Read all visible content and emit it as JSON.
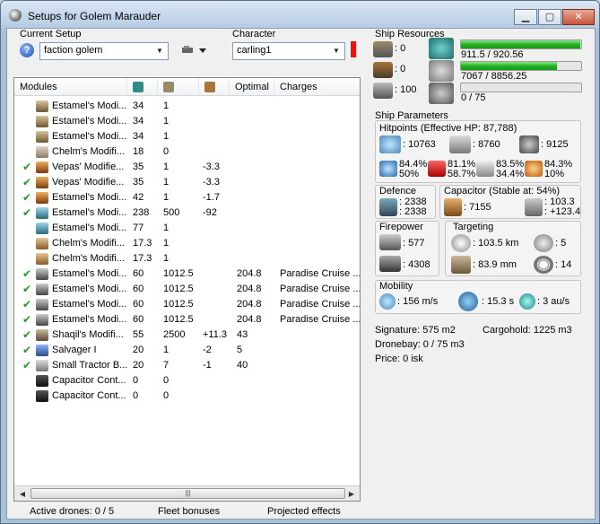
{
  "window": {
    "title": "Setups for Golem Marauder",
    "minimize_glyph": "▁",
    "maximize_glyph": "▢",
    "close_glyph": "✕"
  },
  "current_setup": {
    "label": "Current Setup",
    "value": "faction golem",
    "help_glyph": "?"
  },
  "character": {
    "label": "Character",
    "value": "carling1"
  },
  "modules": {
    "columns": {
      "name": "Modules",
      "optimal": "Optimal",
      "charges": "Charges"
    },
    "header_icons": [
      "cpu-icon",
      "powergrid-icon",
      "capacitor-icon"
    ],
    "rows": [
      {
        "checked": false,
        "icon": "rig-icon",
        "name": "Estamel's Modi...",
        "cpu": "34",
        "pg": "1",
        "cap": "",
        "optimal": "",
        "charges": ""
      },
      {
        "checked": false,
        "icon": "rig-icon",
        "name": "Estamel's Modi...",
        "cpu": "34",
        "pg": "1",
        "cap": "",
        "optimal": "",
        "charges": ""
      },
      {
        "checked": false,
        "icon": "rig-icon",
        "name": "Estamel's Modi...",
        "cpu": "34",
        "pg": "1",
        "cap": "",
        "optimal": "",
        "charges": ""
      },
      {
        "checked": false,
        "icon": "sensor-icon",
        "name": "Chelm's Modifi...",
        "cpu": "18",
        "pg": "0",
        "cap": "",
        "optimal": "",
        "charges": ""
      },
      {
        "checked": true,
        "icon": "hardener-icon",
        "name": "Vepas' Modifie...",
        "cpu": "35",
        "pg": "1",
        "cap": "-3.3",
        "optimal": "",
        "charges": ""
      },
      {
        "checked": true,
        "icon": "hardener-icon",
        "name": "Vepas' Modifie...",
        "cpu": "35",
        "pg": "1",
        "cap": "-3.3",
        "optimal": "",
        "charges": ""
      },
      {
        "checked": true,
        "icon": "hardener-icon",
        "name": "Estamel's Modi...",
        "cpu": "42",
        "pg": "1",
        "cap": "-1.7",
        "optimal": "",
        "charges": ""
      },
      {
        "checked": true,
        "icon": "booster-icon",
        "name": "Estamel's Modi...",
        "cpu": "238",
        "pg": "500",
        "cap": "-92",
        "optimal": "",
        "charges": ""
      },
      {
        "checked": false,
        "icon": "booster-icon",
        "name": "Estamel's Modi...",
        "cpu": "77",
        "pg": "1",
        "cap": "",
        "optimal": "",
        "charges": ""
      },
      {
        "checked": false,
        "icon": "power-icon",
        "name": "Chelm's Modifi...",
        "cpu": "17.3",
        "pg": "1",
        "cap": "",
        "optimal": "",
        "charges": ""
      },
      {
        "checked": false,
        "icon": "power-icon",
        "name": "Chelm's Modifi...",
        "cpu": "17.3",
        "pg": "1",
        "cap": "",
        "optimal": "",
        "charges": ""
      },
      {
        "checked": true,
        "icon": "launcher-icon",
        "name": "Estamel's Modi...",
        "cpu": "60",
        "pg": "1012.5",
        "cap": "",
        "optimal": "204.8",
        "charges": "Paradise Cruise ..."
      },
      {
        "checked": true,
        "icon": "launcher-icon",
        "name": "Estamel's Modi...",
        "cpu": "60",
        "pg": "1012.5",
        "cap": "",
        "optimal": "204.8",
        "charges": "Paradise Cruise ..."
      },
      {
        "checked": true,
        "icon": "launcher-icon",
        "name": "Estamel's Modi...",
        "cpu": "60",
        "pg": "1012.5",
        "cap": "",
        "optimal": "204.8",
        "charges": "Paradise Cruise ..."
      },
      {
        "checked": true,
        "icon": "launcher-icon",
        "name": "Estamel's Modi...",
        "cpu": "60",
        "pg": "1012.5",
        "cap": "",
        "optimal": "204.8",
        "charges": "Paradise Cruise ..."
      },
      {
        "checked": true,
        "icon": "painter-icon",
        "name": "Shaqil's Modifi...",
        "cpu": "55",
        "pg": "2500",
        "cap": "+11.3",
        "optimal": "43",
        "charges": ""
      },
      {
        "checked": true,
        "icon": "salvager-icon",
        "name": "Salvager I",
        "cpu": "20",
        "pg": "1",
        "cap": "-2",
        "optimal": "5",
        "charges": ""
      },
      {
        "checked": true,
        "icon": "tractor-icon",
        "name": "Small Tractor B...",
        "cpu": "20",
        "pg": "7",
        "cap": "-1",
        "optimal": "40",
        "charges": ""
      },
      {
        "checked": false,
        "icon": "capacitor-rig-icon",
        "name": "Capacitor Cont...",
        "cpu": "0",
        "pg": "0",
        "cap": "",
        "optimal": "",
        "charges": ""
      },
      {
        "checked": false,
        "icon": "capacitor-rig-icon",
        "name": "Capacitor Cont...",
        "cpu": "0",
        "pg": "0",
        "cap": "",
        "optimal": "",
        "charges": ""
      }
    ]
  },
  "status": {
    "drones": "Active drones: 0 / 5",
    "fleet": "Fleet bonuses",
    "projected": "Projected effects"
  },
  "ship_resources": {
    "title": "Ship Resources",
    "turret_slots": ": 0",
    "launcher_slots": ": 0",
    "calibration": ": 100",
    "cpu": {
      "text": "911.5 / 920.56",
      "fraction": 0.99
    },
    "powergrid": {
      "text": "7067 / 8856.25",
      "fraction": 0.8
    },
    "drone_bandwidth": {
      "text": "0 / 75",
      "fraction": 0.0
    }
  },
  "ship_parameters": {
    "title": "Ship Parameters",
    "hitpoints_title": "Hitpoints (Effective HP: 87,788)",
    "shield_hp": ": 10763",
    "armor_hp": ": 8760",
    "hull_hp": ": 9125",
    "resists": [
      {
        "top": "84.4%",
        "bottom": "50%"
      },
      {
        "top": "81.1%",
        "bottom": "58.7%"
      },
      {
        "top": "83.5%",
        "bottom": "34.4%"
      },
      {
        "top": "84.3%",
        "bottom": "10%"
      }
    ],
    "defence_title": "Defence",
    "defence_top": ": 2338",
    "defence_bottom": ": 2338",
    "capacitor_title": "Capacitor (Stable at: 54%)",
    "capacitor_amount": ": 7155",
    "capacitor_delta_top": ": 103.3",
    "capacitor_delta_bottom": ": +123.4",
    "firepower_title": "Firepower",
    "firepower_dps": ": 577",
    "firepower_volley": ": 4308",
    "targeting_title": "Targeting",
    "targeting_range": ": 103.5 km",
    "targeting_max_targets": ": 5",
    "targeting_scan_res": ": 83.9 mm",
    "targeting_sensor": ": 14",
    "mobility_title": "Mobility",
    "velocity": ": 156 m/s",
    "align_time": ": 15.3 s",
    "warp_speed": ": 3 au/s",
    "signature": "Signature: 575 m2",
    "cargohold": "Cargohold: 1225 m3",
    "dronebay": "Dronebay: 0 / 75 m3",
    "price": "Price: 0 isk"
  }
}
